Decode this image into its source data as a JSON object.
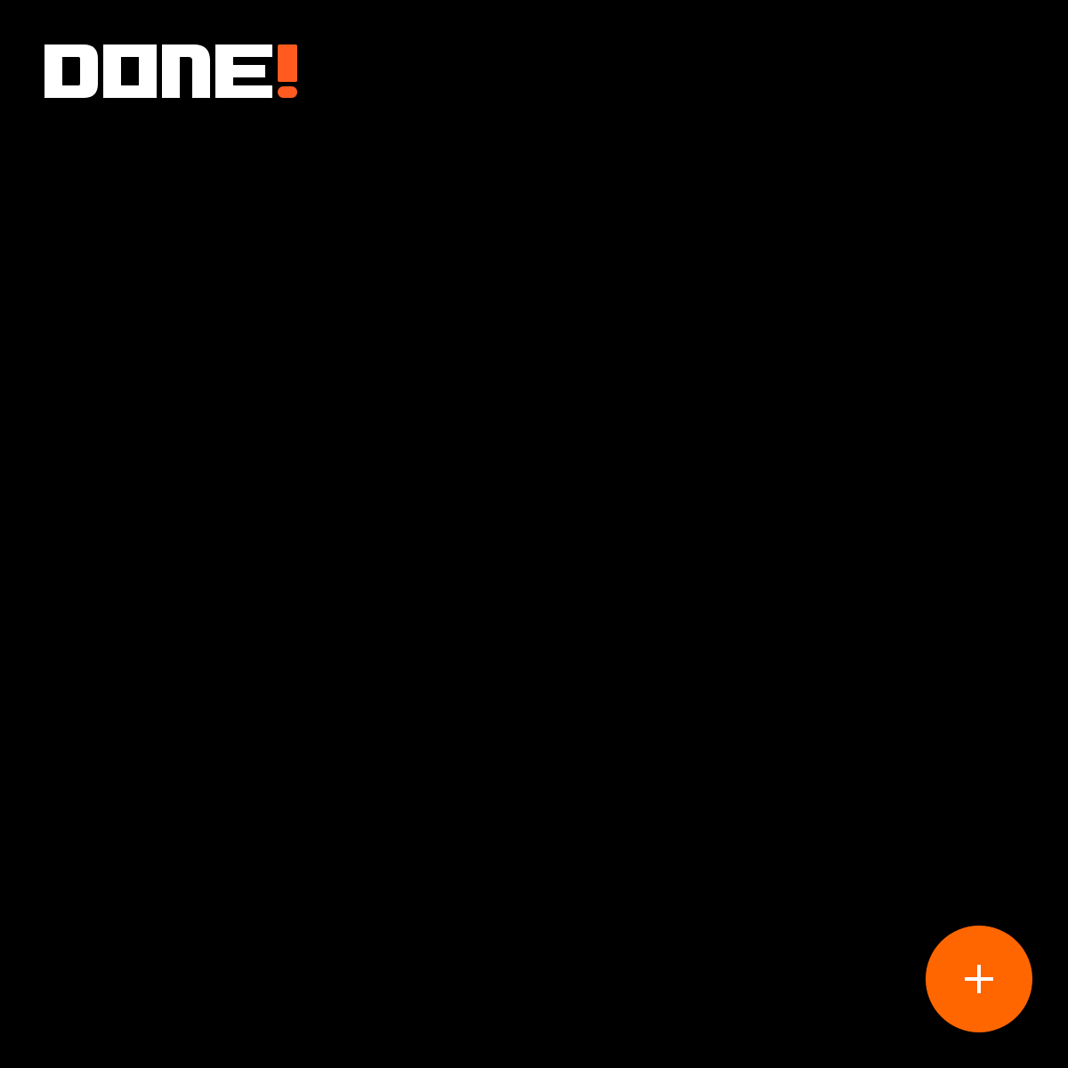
{
  "app": {
    "logo_text": "DONE!",
    "logo_letters": "DONE",
    "logo_exclamation": "!"
  },
  "fab": {
    "icon": "plus-icon",
    "label": "+"
  },
  "colors": {
    "background": "#000000",
    "logo_text": "#ffffff",
    "accent": "#ff6600",
    "logo_accent": "#ff5a1f",
    "fab_icon": "#ffffff"
  }
}
